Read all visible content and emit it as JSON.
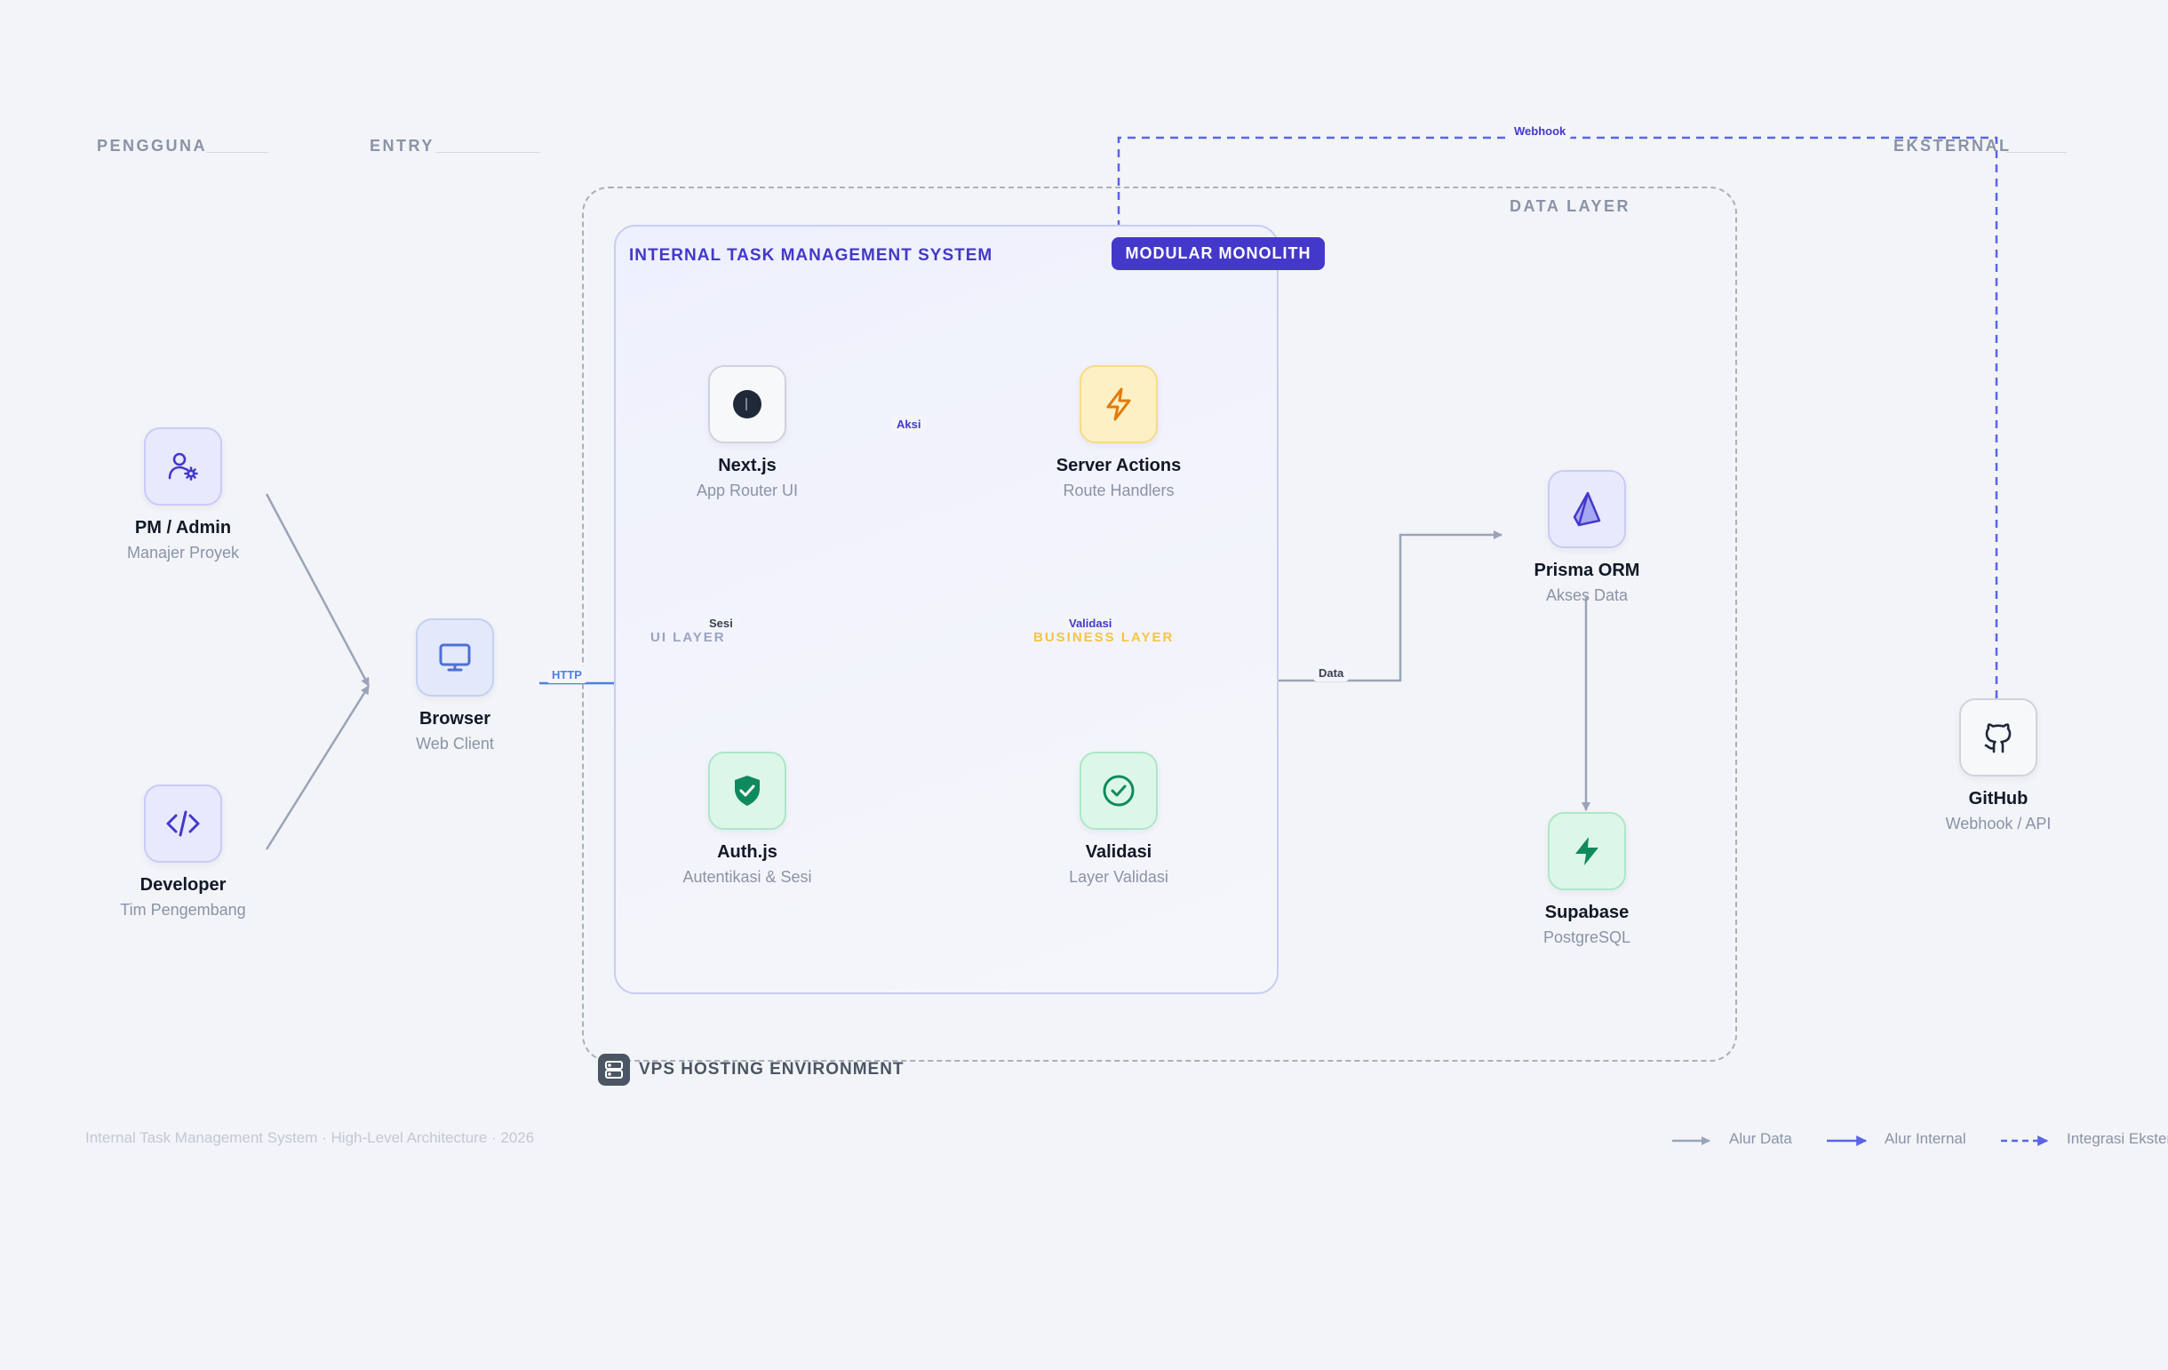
{
  "sections": {
    "pengguna": "PENGGUNA",
    "entry": "ENTRY",
    "eksternal": "EKSTERNAL",
    "data_layer": "DATA LAYER"
  },
  "system": {
    "title": "INTERNAL TASK MANAGEMENT SYSTEM",
    "badge": "MODULAR MONOLITH",
    "ui_layer": "UI LAYER",
    "business_layer": "BUSINESS LAYER",
    "vps_label": "VPS HOSTING ENVIRONMENT"
  },
  "nodes": {
    "pm_admin": {
      "title": "PM / Admin",
      "subtitle": "Manajer Proyek",
      "icon": "user-gear-icon"
    },
    "developer": {
      "title": "Developer",
      "subtitle": "Tim Pengembang",
      "icon": "code-icon"
    },
    "browser": {
      "title": "Browser",
      "subtitle": "Web Client",
      "icon": "monitor-icon"
    },
    "nextjs": {
      "title": "Next.js",
      "subtitle": "App Router UI",
      "icon": "nextjs-icon"
    },
    "server_actions": {
      "title": "Server Actions",
      "subtitle": "Route Handlers",
      "icon": "lightning-icon"
    },
    "authjs": {
      "title": "Auth.js",
      "subtitle": "Autentikasi & Sesi",
      "icon": "shield-check-icon"
    },
    "validasi": {
      "title": "Validasi",
      "subtitle": "Layer Validasi",
      "icon": "check-circle-icon"
    },
    "prisma": {
      "title": "Prisma ORM",
      "subtitle": "Akses Data",
      "icon": "prisma-icon"
    },
    "supabase": {
      "title": "Supabase",
      "subtitle": "PostgreSQL",
      "icon": "supabase-bolt-icon"
    },
    "github": {
      "title": "GitHub",
      "subtitle": "Webhook / API",
      "icon": "github-icon"
    }
  },
  "edges": {
    "http": "HTTP",
    "aksi": "Aksi",
    "sesi": "Sesi",
    "validasi": "Validasi",
    "data": "Data",
    "webhook": "Webhook"
  },
  "footer": "Internal Task Management System · High-Level Architecture · 2026",
  "legend": {
    "alur_data": "Alur Data",
    "alur_internal": "Alur Internal",
    "integrasi_eksternal": "Integrasi Eksternal"
  },
  "colors": {
    "background": "#f2f4f8",
    "accent": "#4338ca",
    "internal_flow": "#5b63e6",
    "data_flow": "#9aa3b8",
    "http_flow": "#4f7ee0",
    "business_layer": "#f6c343"
  }
}
